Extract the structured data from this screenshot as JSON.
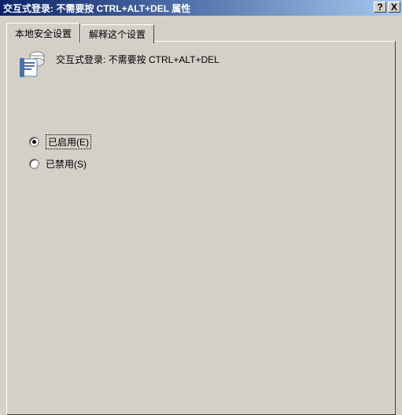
{
  "window": {
    "title": "交互式登录: 不需要按 CTRL+ALT+DEL 属性"
  },
  "tabs": {
    "local": "本地安全设置",
    "explain": "解释这个设置"
  },
  "policy": {
    "name": "交互式登录: 不需要按 CTRL+ALT+DEL"
  },
  "options": {
    "enabled": "已启用(E)",
    "disabled": "已禁用(S)"
  },
  "icons": {
    "help": "?",
    "close": "X"
  }
}
